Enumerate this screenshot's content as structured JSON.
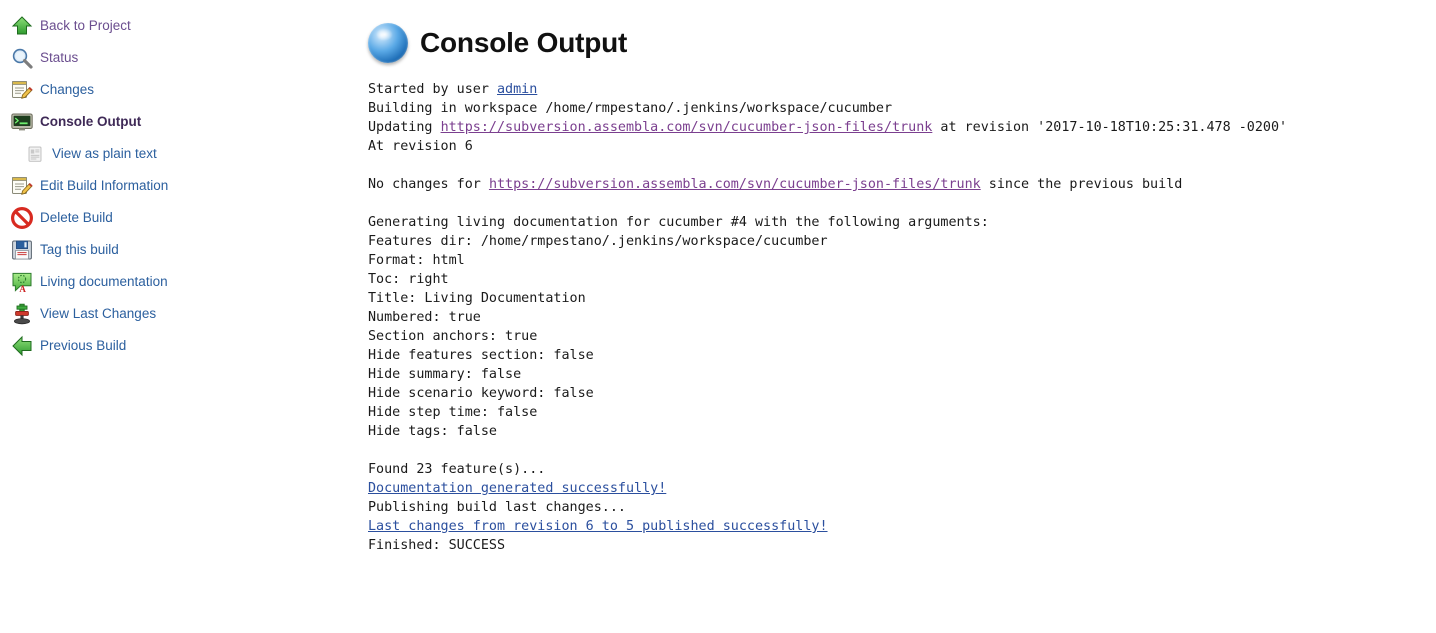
{
  "sidebar": {
    "items": [
      {
        "label": "Back to Project",
        "icon": "up-arrow-icon",
        "name": "sidebar-item-back-to-project",
        "style": "lnk-visited",
        "indented": false
      },
      {
        "label": "Status",
        "icon": "magnifier-icon",
        "name": "sidebar-item-status",
        "style": "lnk-visited",
        "indented": false
      },
      {
        "label": "Changes",
        "icon": "notepad-pencil-icon",
        "name": "sidebar-item-changes",
        "style": "lnk-blue",
        "indented": false
      },
      {
        "label": "Console Output",
        "icon": "terminal-icon",
        "name": "sidebar-item-console-output",
        "style": "lnk-active",
        "indented": false
      },
      {
        "label": "View as plain text",
        "icon": "document-icon",
        "name": "sidebar-item-view-as-plain-text",
        "style": "lnk-blue",
        "indented": true
      },
      {
        "label": "Edit Build Information",
        "icon": "notepad-pencil-icon",
        "name": "sidebar-item-edit-build-information",
        "style": "lnk-blue",
        "indented": false
      },
      {
        "label": "Delete Build",
        "icon": "no-entry-icon",
        "name": "sidebar-item-delete-build",
        "style": "lnk-blue",
        "indented": false
      },
      {
        "label": "Tag this build",
        "icon": "floppy-disk-icon",
        "name": "sidebar-item-tag-this-build",
        "style": "lnk-blue",
        "indented": false
      },
      {
        "label": "Living documentation",
        "icon": "speech-bubble-icon",
        "name": "sidebar-item-living-documentation",
        "style": "lnk-blue",
        "indented": false
      },
      {
        "label": "View Last Changes",
        "icon": "plug-icon",
        "name": "sidebar-item-view-last-changes",
        "style": "lnk-blue",
        "indented": false
      },
      {
        "label": "Previous Build",
        "icon": "left-arrow-icon",
        "name": "sidebar-item-previous-build",
        "style": "lnk-blue",
        "indented": false
      }
    ]
  },
  "header": {
    "title": "Console Output",
    "icon": "blue-sphere-icon"
  },
  "console": {
    "lines": [
      {
        "parts": [
          {
            "t": "Started by user "
          },
          {
            "t": "admin",
            "link": "blue"
          }
        ]
      },
      {
        "parts": [
          {
            "t": "Building in workspace /home/rmpestano/.jenkins/workspace/cucumber"
          }
        ]
      },
      {
        "parts": [
          {
            "t": "Updating "
          },
          {
            "t": "https://subversion.assembla.com/svn/cucumber-json-files/trunk",
            "link": "visited"
          },
          {
            "t": " at revision '2017-10-18T10:25:31.478 -0200'"
          }
        ]
      },
      {
        "parts": [
          {
            "t": "At revision 6"
          }
        ]
      },
      {
        "blank": true
      },
      {
        "parts": [
          {
            "t": "No changes for "
          },
          {
            "t": "https://subversion.assembla.com/svn/cucumber-json-files/trunk",
            "link": "visited"
          },
          {
            "t": " since the previous build"
          }
        ]
      },
      {
        "blank": true
      },
      {
        "parts": [
          {
            "t": "Generating living documentation for cucumber #4 with the following arguments:"
          }
        ]
      },
      {
        "parts": [
          {
            "t": "Features dir: /home/rmpestano/.jenkins/workspace/cucumber"
          }
        ]
      },
      {
        "parts": [
          {
            "t": "Format: html"
          }
        ]
      },
      {
        "parts": [
          {
            "t": "Toc: right"
          }
        ]
      },
      {
        "parts": [
          {
            "t": "Title: Living Documentation"
          }
        ]
      },
      {
        "parts": [
          {
            "t": "Numbered: true"
          }
        ]
      },
      {
        "parts": [
          {
            "t": "Section anchors: true"
          }
        ]
      },
      {
        "parts": [
          {
            "t": "Hide features section: false"
          }
        ]
      },
      {
        "parts": [
          {
            "t": "Hide summary: false"
          }
        ]
      },
      {
        "parts": [
          {
            "t": "Hide scenario keyword: false"
          }
        ]
      },
      {
        "parts": [
          {
            "t": "Hide step time: false"
          }
        ]
      },
      {
        "parts": [
          {
            "t": "Hide tags: false"
          }
        ]
      },
      {
        "blank": true
      },
      {
        "parts": [
          {
            "t": "Found 23 feature(s)..."
          }
        ]
      },
      {
        "parts": [
          {
            "t": "Documentation generated successfully!",
            "link": "blue"
          }
        ]
      },
      {
        "parts": [
          {
            "t": "Publishing build last changes..."
          }
        ]
      },
      {
        "parts": [
          {
            "t": "Last changes from revision 6 to 5 published successfully!",
            "link": "blue"
          }
        ]
      },
      {
        "parts": [
          {
            "t": "Finished: SUCCESS"
          }
        ]
      }
    ]
  },
  "colors": {
    "link_blue": "#2b4f9e",
    "link_visited": "#7b3f8f",
    "active_item": "#3f2a57",
    "console_text": "#1a1a1a"
  }
}
